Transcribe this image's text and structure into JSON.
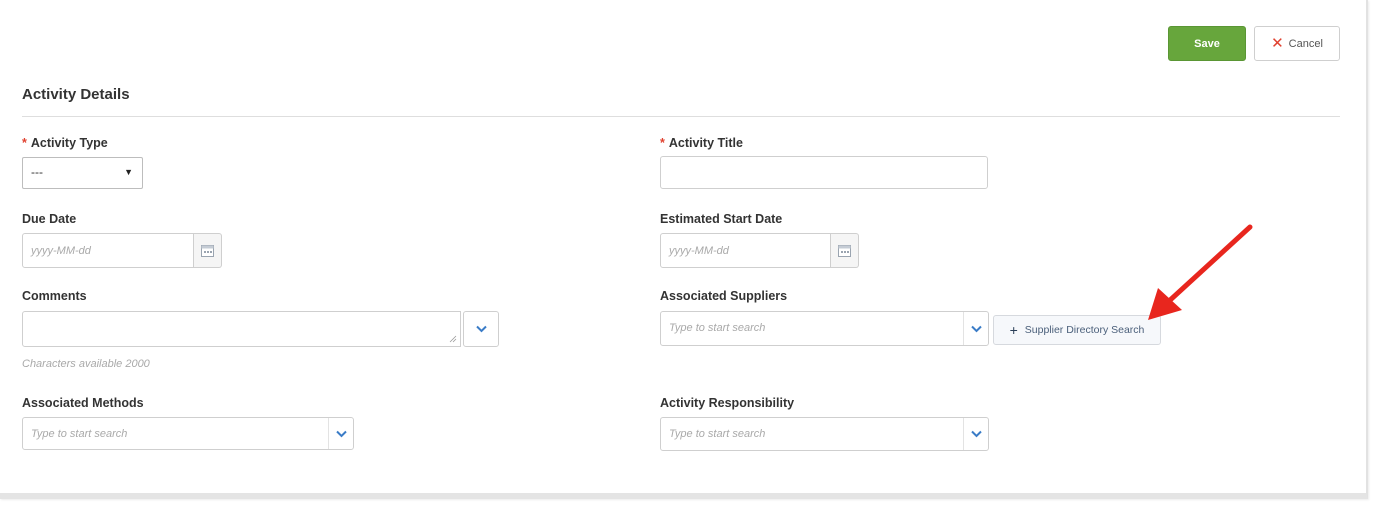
{
  "toolbar": {
    "save_label": "Save",
    "cancel_label": "Cancel"
  },
  "section": {
    "title": "Activity Details"
  },
  "fields": {
    "activity_type": {
      "label": "Activity Type",
      "required_mark": "*",
      "value": "---"
    },
    "activity_title": {
      "label": "Activity Title",
      "required_mark": "*",
      "value": ""
    },
    "due_date": {
      "label": "Due Date",
      "placeholder": "yyyy-MM-dd"
    },
    "estimated_start_date": {
      "label": "Estimated Start Date",
      "placeholder": "yyyy-MM-dd"
    },
    "comments": {
      "label": "Comments",
      "hint": "Characters available 2000"
    },
    "associated_suppliers": {
      "label": "Associated Suppliers",
      "placeholder": "Type to start search",
      "directory_button": "Supplier Directory Search",
      "directory_button_icon": "+"
    },
    "associated_methods": {
      "label": "Associated Methods",
      "placeholder": "Type to start search"
    },
    "activity_responsibility": {
      "label": "Activity Responsibility",
      "placeholder": "Type to start search"
    }
  },
  "icons": {
    "cancel": "close-icon",
    "calendar": "calendar-icon",
    "dropdown": "chevron-down-icon",
    "add": "plus-icon",
    "annotation": "red-arrow-icon"
  },
  "colors": {
    "save_button": "#67a63c",
    "required_asterisk": "#e0412f",
    "cancel_x": "#e0412f",
    "chevron": "#3a7cc7",
    "annotation_arrow": "#e8261e"
  }
}
